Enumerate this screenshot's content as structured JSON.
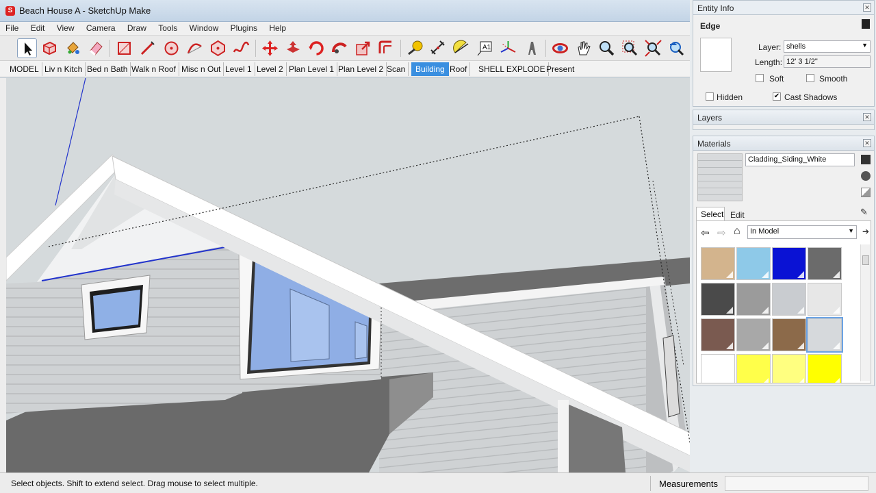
{
  "window": {
    "title": "Beach House A - SketchUp Make"
  },
  "menu": [
    "File",
    "Edit",
    "View",
    "Camera",
    "Draw",
    "Tools",
    "Window",
    "Plugins",
    "Help"
  ],
  "toolbar_icons": [
    "select-icon",
    "make-component-icon",
    "paint-bucket-icon",
    "eraser-icon",
    "rectangle-icon",
    "line-icon",
    "circle-icon",
    "arc-icon",
    "polygon-icon",
    "freehand-icon",
    "move-icon",
    "push-pull-icon",
    "rotate-icon",
    "follow-me-icon",
    "scale-icon",
    "offset-icon",
    "tape-measure-icon",
    "dimension-icon",
    "protractor-icon",
    "text-icon",
    "axes-icon",
    "3d-text-icon",
    "orbit-icon",
    "pan-icon",
    "zoom-icon",
    "zoom-window-icon",
    "zoom-extents-icon",
    "previous-icon"
  ],
  "scenes": [
    "MODEL",
    "Liv n Kitch",
    "Bed n Bath",
    "Walk n Roof",
    "Misc n Out",
    "Level 1",
    "Level 2",
    "Plan Level 1",
    "Plan Level 2",
    "Scan",
    "Building",
    "Roof",
    "SHELL EXPLODE",
    "Present"
  ],
  "active_scene": "Building",
  "entity_info": {
    "panel_title": "Entity Info",
    "type": "Edge",
    "layer_label": "Layer:",
    "layer_value": "shells",
    "length_label": "Length:",
    "length_value": "12' 3 1/2\"",
    "soft_label": "Soft",
    "soft_checked": false,
    "smooth_label": "Smooth",
    "smooth_checked": false,
    "hidden_label": "Hidden",
    "hidden_checked": false,
    "cast_shadows_label": "Cast Shadows",
    "cast_shadows_checked": true,
    "checked_glyph": "✔"
  },
  "layers": {
    "panel_title": "Layers"
  },
  "materials": {
    "panel_title": "Materials",
    "material_name": "Cladding_Siding_White",
    "tab_select": "Select",
    "tab_edit": "Edit",
    "collection": "In Model",
    "swatches": [
      {
        "color": "#d3b48d"
      },
      {
        "color": "#8ec9e8"
      },
      {
        "color": "#0a12d4"
      },
      {
        "color": "#6b6b6b"
      },
      {
        "color": "#4a4a4a"
      },
      {
        "color": "#9b9b9b"
      },
      {
        "color": "#c9ccd0"
      },
      {
        "color": "#e7e7e7"
      },
      {
        "color": "#7a5a50"
      },
      {
        "color": "#a8a8a8"
      },
      {
        "color": "#8c6a4a"
      },
      {
        "color": "#d6d9dc",
        "selected": true
      },
      {
        "color": "#ffffff"
      },
      {
        "color": "#ffff4a"
      },
      {
        "color": "#ffff80"
      },
      {
        "color": "#ffff00"
      }
    ]
  },
  "status": {
    "message": "Select objects. Shift to extend select. Drag mouse to select multiple.",
    "measurements_label": "Measurements"
  },
  "colors": {
    "accent": "#3a8fe0",
    "siding": "#c9ccce",
    "roof_dark": "#6e6e6e",
    "window_glass": "#8fb0e6"
  }
}
